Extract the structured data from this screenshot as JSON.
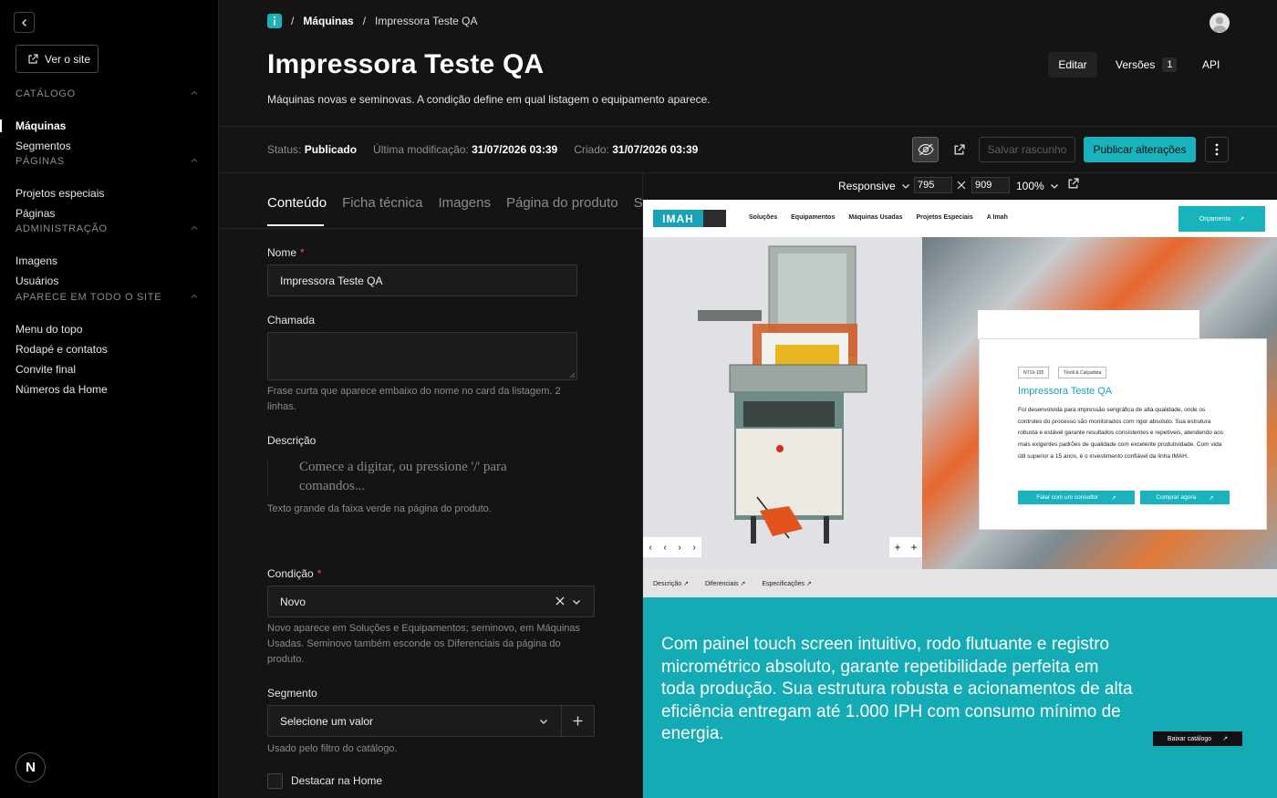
{
  "sidebar": {
    "view_site": "Ver o site",
    "groups": [
      {
        "title": "CATÁLOGO",
        "items": [
          "Máquinas",
          "Segmentos"
        ]
      },
      {
        "title": "PÁGINAS",
        "items": [
          "Projetos especiais",
          "Páginas"
        ]
      },
      {
        "title": "ADMINISTRAÇÃO",
        "items": [
          "Imagens",
          "Usuários"
        ]
      },
      {
        "title": "APARECE EM TODO O SITE",
        "items": [
          "Menu do topo",
          "Rodapé e contatos",
          "Convite final",
          "Números da Home"
        ]
      }
    ],
    "active_item": "Máquinas",
    "logo_letter": "N"
  },
  "header": {
    "breadcrumb": [
      "Máquinas",
      "Impressora Teste QA"
    ],
    "title": "Impressora Teste QA",
    "description": "Máquinas novas e seminovas. A condição define em qual listagem o equipamento aparece.",
    "edit": "Editar",
    "versions": "Versões",
    "versions_count": "1",
    "api": "API"
  },
  "status": {
    "status_label": "Status:",
    "status_value": "Publicado",
    "modified_label": "Última modificação:",
    "modified_value": "31/07/2026 03:39",
    "created_label": "Criado:",
    "created_value": "31/07/2026 03:39",
    "save_draft": "Salvar rascunho",
    "publish": "Publicar alterações"
  },
  "form": {
    "tabs": [
      "Conteúdo",
      "Ficha técnica",
      "Imagens",
      "Página do produto",
      "SE"
    ],
    "name_label": "Nome",
    "name_value": "Impressora Teste QA",
    "tagline_label": "Chamada",
    "tagline_help": "Frase curta que aparece embaixo do nome no card da listagem. 2 linhas.",
    "description_label": "Descrição",
    "description_placeholder": "Comece a digitar, ou pressione '/' para comandos...",
    "description_help": "Texto grande da faixa verde na página do produto.",
    "condition_label": "Condição",
    "condition_value": "Novo",
    "condition_help": "Novo aparece em Soluções e Equipamentos; seminovo, em Máquinas Usadas. Seminovo também esconde os Diferenciais da página do produto.",
    "segment_label": "Segmento",
    "segment_value": "Selecione um valor",
    "segment_help": "Usado pelo filtro do catálogo.",
    "featured_label": "Destacar na Home"
  },
  "preview_toolbar": {
    "mode": "Responsive",
    "width": "795",
    "height": "909",
    "zoom": "100%"
  },
  "preview_site": {
    "logo": "IMAH",
    "menu": [
      "Soluções",
      "Equipamentos",
      "Máquinas Usadas",
      "Projetos Especiais",
      "A Imah"
    ],
    "cta": "Orçamento",
    "tags": [
      "NT10-105",
      "Têxtil & Calçadista"
    ],
    "card_title": "Impressora Teste QA",
    "card_text": "Foi desenvolvida para impressão serigráfica de alta qualidade, onde os controles do processo são monitorados com rigor absoluto. Sua estrutura robusta e estável garante resultados consistentes e repetíveis, atendendo aos mais exigentes padrões de qualidade com excelente produtividade. Com vida útil superior a 15 anos, é o investimento confiável da linha IMAH.",
    "btn_consultant": "Falar com um consultor",
    "btn_buy": "Comprar agora",
    "tabs": [
      "Descrição",
      "Diferenciais",
      "Especificações"
    ],
    "big_text": "Com painel touch screen intuitivo, rodo flutuante e registro micrométrico absoluto, garante repetibilidade perfeita em toda produção. Sua estrutura robusta e acionamentos de alta eficiência entregam até 1.000 IPH com consumo mínimo de energia.",
    "download": "Baixar catálogo"
  },
  "colors": {
    "accent": "#17b4be",
    "background": "#141414",
    "sidebar": "#000000"
  }
}
